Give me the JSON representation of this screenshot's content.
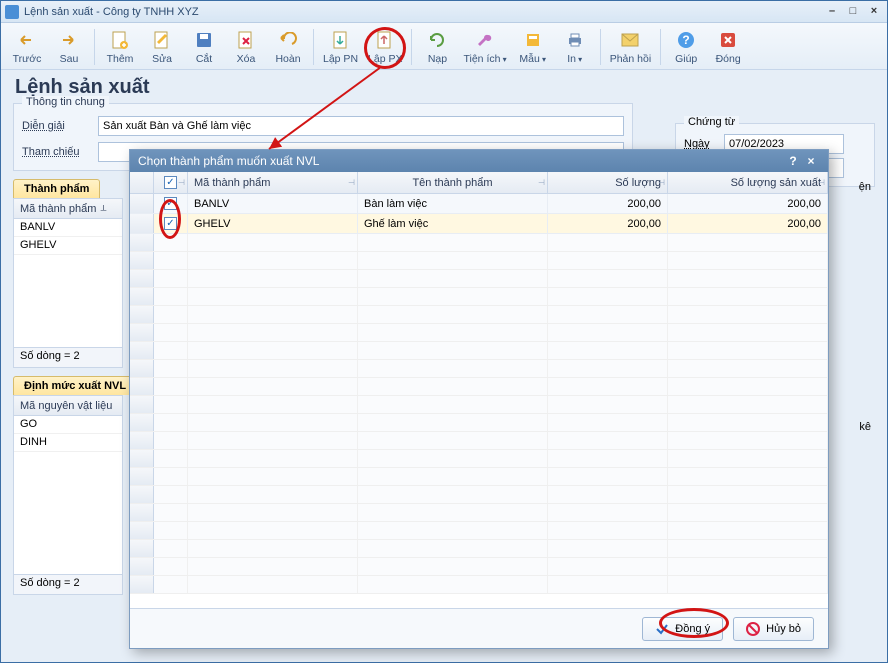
{
  "window": {
    "title": "Lệnh sản xuất - Công ty TNHH XYZ"
  },
  "toolbar": {
    "back": "Trước",
    "forward": "Sau",
    "add": "Thêm",
    "edit": "Sửa",
    "cut": "Cắt",
    "delete": "Xóa",
    "undo": "Hoàn",
    "lap_pn": "Lập PN",
    "lap_px": "Lập PX",
    "reload": "Nạp",
    "util": "Tiện ích",
    "template": "Mẫu",
    "print": "In",
    "feedback": "Phản hồi",
    "help": "Giúp",
    "close": "Đóng"
  },
  "page_title": "Lệnh sản xuất",
  "group_general": {
    "title": "Thông tin chung",
    "label_diengiai": "Diễn giải",
    "value_diengiai": "Sản xuất Bàn và Ghế làm việc",
    "label_thamchieu": "Tham chiếu",
    "value_thamchieu": ""
  },
  "group_doc": {
    "title": "Chứng từ",
    "label_ngay": "Ngày",
    "value_ngay": "07/02/2023"
  },
  "tab_products": "Thành phẩm",
  "tab_materials": "Định mức xuất NVL",
  "grid_products": {
    "header_code": "Mã thành phẩm",
    "rows": [
      "BANLV",
      "GHELV"
    ],
    "status": "Số dòng = 2"
  },
  "grid_materials": {
    "header_code": "Mã nguyên vật liệu",
    "rows": [
      "GO",
      "DINH"
    ],
    "status": "Số dòng = 2"
  },
  "right_label_ke": "kê",
  "right_label_en": "ện",
  "modal": {
    "title": "Chọn thành phẩm muốn xuất NVL",
    "headers": {
      "code": "Mã thành phẩm",
      "name": "Tên thành phẩm",
      "qty": "Số lượng",
      "prod_qty": "Số lượng sản xuất"
    },
    "rows": [
      {
        "checked": true,
        "code": "BANLV",
        "name": "Bàn làm việc",
        "qty": "200,00",
        "prod_qty": "200,00"
      },
      {
        "checked": true,
        "code": "GHELV",
        "name": "Ghế làm việc",
        "qty": "200,00",
        "prod_qty": "200,00"
      }
    ],
    "btn_ok": "Đồng ý",
    "btn_cancel": "Hủy bỏ"
  }
}
